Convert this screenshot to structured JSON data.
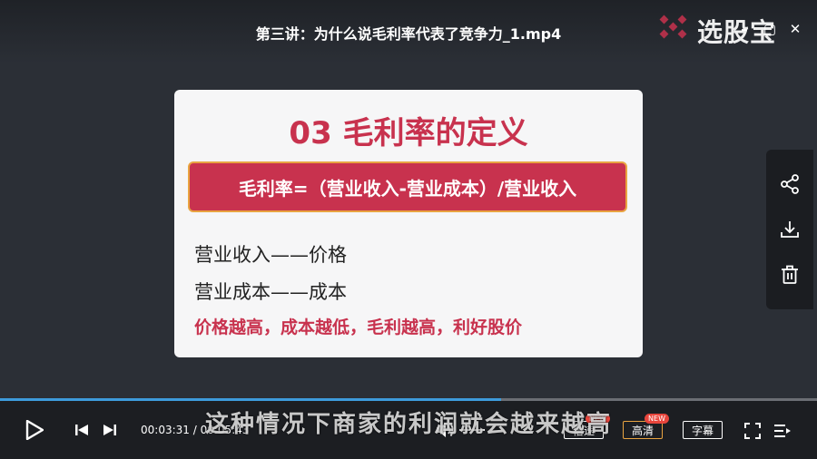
{
  "header": {
    "video_title": "第三讲：为什么说毛利率代表了竞争力_1.mp4",
    "brand_name": "选股宝"
  },
  "slide": {
    "title": "03 毛利率的定义",
    "formula": "毛利率=（营业收入-营业成本）/营业收入",
    "line1": "营业收入——价格",
    "line2": "营业成本——成本",
    "highlight": "价格越高，成本越低，毛利越高，利好股价"
  },
  "side_panel": {
    "icons": [
      "share-icon",
      "download-icon",
      "delete-icon"
    ]
  },
  "player": {
    "progress": 0.613,
    "current_time": "00:03:31",
    "separator": "/",
    "duration": "00:05:43",
    "subtitle": "这种情况下商家的利润就会越来越高",
    "speed_label": "倍速",
    "quality_label": "高清",
    "caption_label": "字幕",
    "new_badge": "NEW"
  },
  "colors": {
    "accent_red": "#c8324e",
    "progress_blue": "#3d9bdb",
    "badge_red": "#e8453c"
  }
}
